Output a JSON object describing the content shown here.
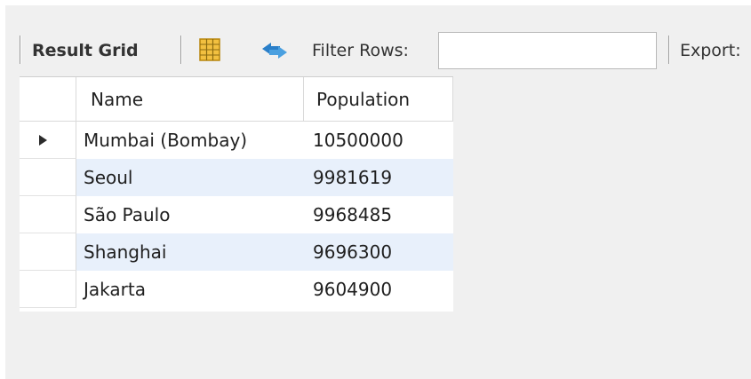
{
  "toolbar": {
    "result_grid_label": "Result Grid",
    "filter_rows_label": "Filter Rows:",
    "filter_value": "",
    "export_label": "Export:"
  },
  "icons": {
    "grid": "grid-layout-icon",
    "refresh": "refresh-arrows-icon"
  },
  "colors": {
    "grid_icon_fill": "#f2c040",
    "refresh_icon": "#2a7fc9",
    "alt_row": "#e8f0fb"
  },
  "table": {
    "columns": [
      "Name",
      "Population"
    ],
    "rows": [
      {
        "name": "Mumbai (Bombay)",
        "population": "10500000",
        "selected": true
      },
      {
        "name": "Seoul",
        "population": "9981619",
        "selected": false
      },
      {
        "name": "São Paulo",
        "population": "9968485",
        "selected": false
      },
      {
        "name": "Shanghai",
        "population": "9696300",
        "selected": false
      },
      {
        "name": "Jakarta",
        "population": "9604900",
        "selected": false
      }
    ]
  }
}
